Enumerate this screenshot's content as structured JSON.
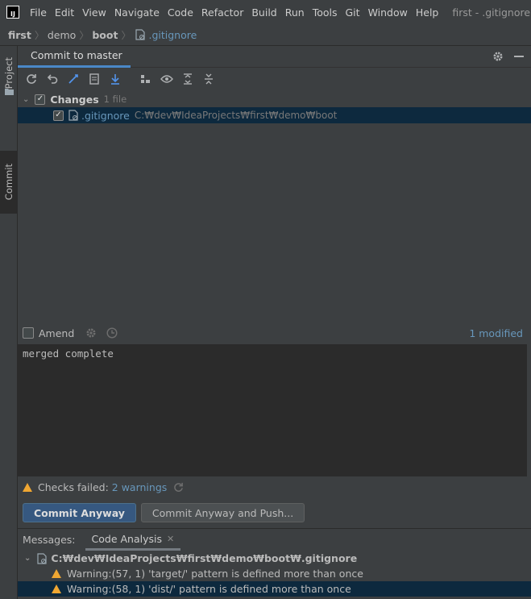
{
  "menubar": {
    "logo": "IJ",
    "items": [
      "File",
      "Edit",
      "View",
      "Navigate",
      "Code",
      "Refactor",
      "Build",
      "Run",
      "Tools",
      "Git",
      "Window",
      "Help"
    ],
    "window_title": "first - .gitignore [boot]"
  },
  "breadcrumb": {
    "items": [
      "first",
      "demo",
      "boot"
    ],
    "file": ".gitignore"
  },
  "sidebar": {
    "tabs": [
      "Project",
      "Commit"
    ]
  },
  "commit_panel": {
    "title": "Commit to master",
    "changes_label": "Changes",
    "changes_count": "1 file",
    "file_name": ".gitignore",
    "file_path": "C:₩dev₩IdeaProjects₩first₩demo₩boot",
    "amend_label": "Amend",
    "modified_text": "1 modified",
    "commit_message": "merged complete",
    "checks_failed_label": "Checks failed:",
    "checks_link": "2 warnings",
    "commit_button": "Commit Anyway",
    "commit_push_button": "Commit Anyway and Push..."
  },
  "bottom_panel": {
    "messages_label": "Messages:",
    "tab_label": "Code Analysis",
    "file_path": "C:₩dev₩IdeaProjects₩first₩demo₩boot₩.gitignore",
    "warnings": [
      "Warning:(57, 1)  'target/' pattern is defined more than once",
      "Warning:(58, 1)  'dist/' pattern is defined more than once"
    ]
  },
  "colors": {
    "accent": "#4a88c7",
    "link": "#6897bb",
    "warning": "#f0a732",
    "selection": "#0d293e"
  }
}
